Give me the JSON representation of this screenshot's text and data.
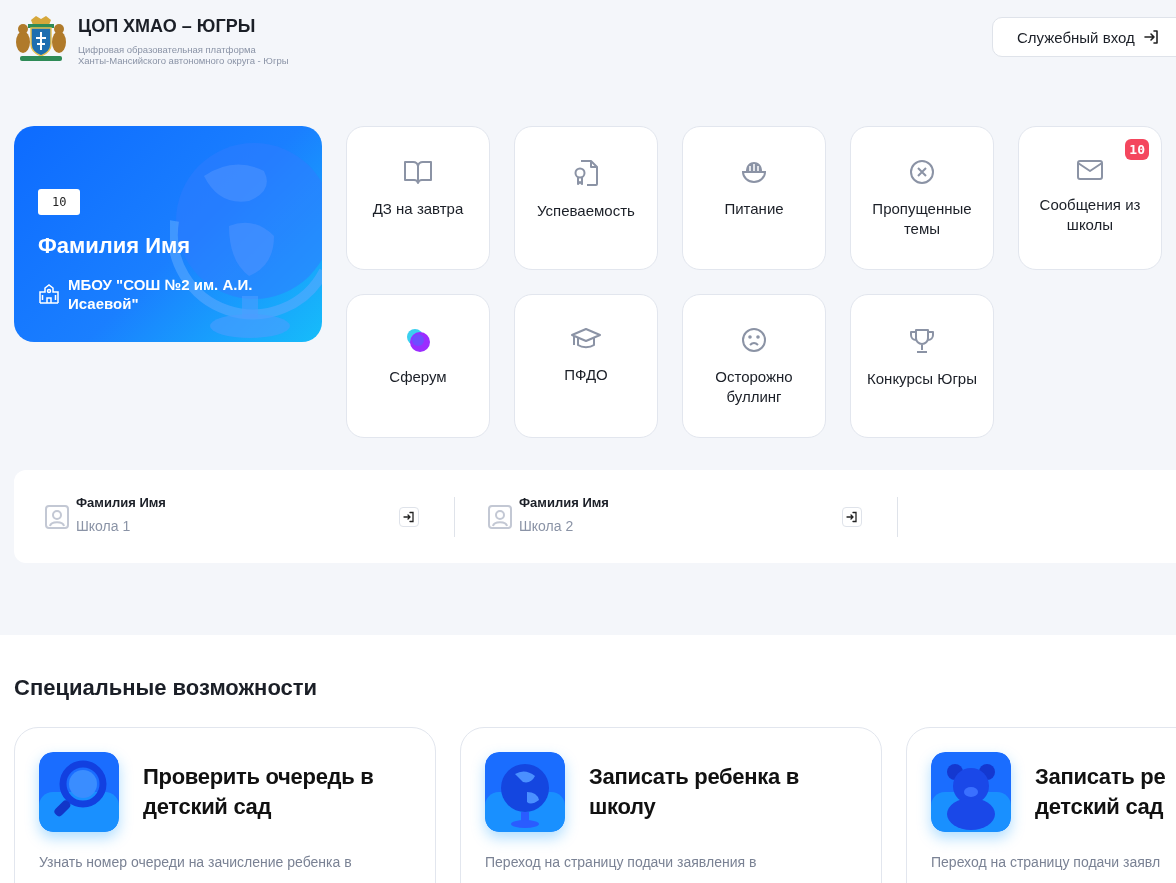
{
  "header": {
    "title": "ЦОП ХМАО – ЮГРЫ",
    "subtitle_lines": [
      "Цифровая образовательная платформа",
      "Ханты-Мансийского автономного округа - Югры"
    ],
    "login_button": "Служебный вход"
  },
  "student": {
    "grade": "10",
    "name": "Фамилия Имя",
    "school": "МБОУ \"СОШ №2 им. А.И. Исаевой\""
  },
  "tiles": [
    {
      "label": "ДЗ на завтра",
      "kind": "book"
    },
    {
      "label": "Успеваемость",
      "kind": "certificate"
    },
    {
      "label": "Питание",
      "kind": "bowl"
    },
    {
      "label": "Пропущенные темы",
      "kind": "cross"
    },
    {
      "label": "Сообщения из школы",
      "kind": "mail",
      "badge": "10"
    },
    {
      "label": "Сферум",
      "kind": "sferum"
    },
    {
      "label": "ПФДО",
      "kind": "cap"
    },
    {
      "label": "Осторожно буллинг",
      "kind": "sad"
    },
    {
      "label": "Конкурсы Югры",
      "kind": "trophy"
    }
  ],
  "accounts": [
    {
      "name": "Фамилия Имя",
      "school": "Школа 1"
    },
    {
      "name": "Фамилия Имя",
      "school": "Школа 2"
    }
  ],
  "special": {
    "title": "Специальные возможности",
    "cards": [
      {
        "title_lines": [
          "Проверить очередь в",
          "детский сад"
        ],
        "description": "Узнать номер очереди на зачисление ребенка в",
        "kind": "magnifier"
      },
      {
        "title_lines": [
          "Записать ребенка в",
          "школу"
        ],
        "description": "Переход на страницу подачи заявления в",
        "kind": "globe"
      },
      {
        "title_lines": [
          "Записать ре",
          "детский сад"
        ],
        "description": "Переход на страницу подачи заявл",
        "kind": "bear"
      }
    ]
  }
}
